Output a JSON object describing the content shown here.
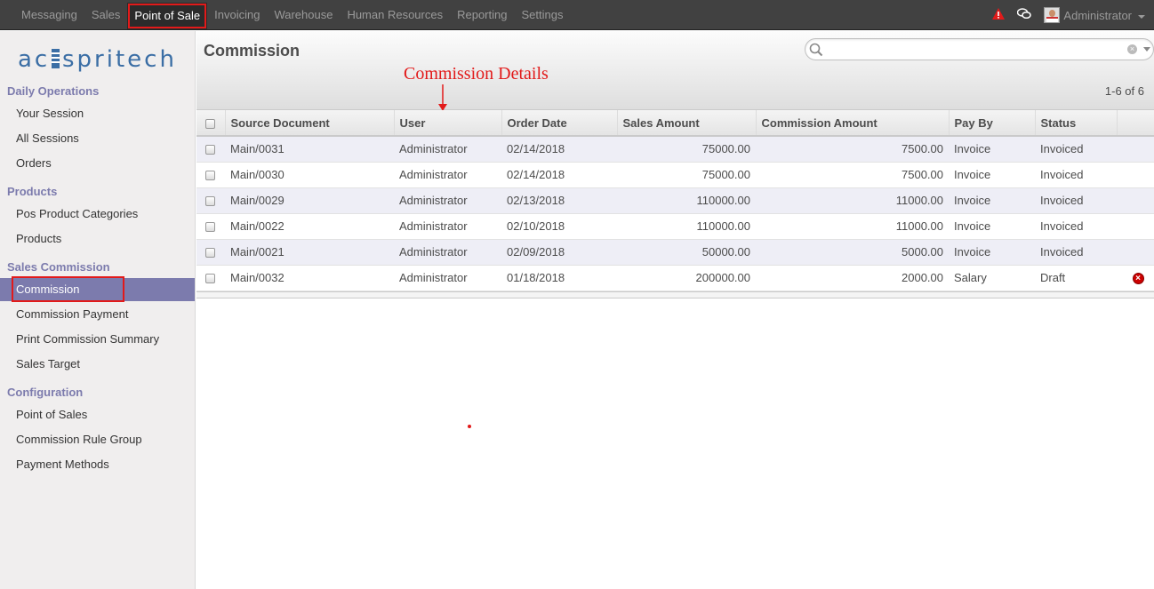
{
  "topbar": {
    "menu": [
      "Messaging",
      "Sales",
      "Point of Sale",
      "Invoicing",
      "Warehouse",
      "Human Resources",
      "Reporting",
      "Settings"
    ],
    "active_index": 2,
    "user_name": "Administrator"
  },
  "sidebar": {
    "logo_text": "acsspritech",
    "sections": [
      {
        "title": "Daily Operations",
        "items": [
          "Your Session",
          "All Sessions",
          "Orders"
        ]
      },
      {
        "title": "Products",
        "items": [
          "Pos Product Categories",
          "Products"
        ]
      },
      {
        "title": "Sales Commission",
        "items": [
          "Commission",
          "Commission Payment",
          "Print Commission Summary",
          "Sales Target"
        ]
      },
      {
        "title": "Configuration",
        "items": [
          "Point of Sales",
          "Commission Rule Group",
          "Payment Methods"
        ]
      }
    ],
    "active_item": "Commission"
  },
  "main": {
    "title": "Commission",
    "search": {
      "value": "",
      "placeholder": ""
    },
    "pager": "1-6 of 6",
    "annotation": "Commission Details"
  },
  "table": {
    "columns": [
      "Source Document",
      "User",
      "Order Date",
      "Sales Amount",
      "Commission Amount",
      "Pay By",
      "Status"
    ],
    "rows": [
      {
        "source": "Main/0031",
        "user": "Administrator",
        "date": "02/14/2018",
        "sales": "75000.00",
        "commission": "7500.00",
        "pay_by": "Invoice",
        "status": "Invoiced",
        "deletable": false
      },
      {
        "source": "Main/0030",
        "user": "Administrator",
        "date": "02/14/2018",
        "sales": "75000.00",
        "commission": "7500.00",
        "pay_by": "Invoice",
        "status": "Invoiced",
        "deletable": false
      },
      {
        "source": "Main/0029",
        "user": "Administrator",
        "date": "02/13/2018",
        "sales": "110000.00",
        "commission": "11000.00",
        "pay_by": "Invoice",
        "status": "Invoiced",
        "deletable": false
      },
      {
        "source": "Main/0022",
        "user": "Administrator",
        "date": "02/10/2018",
        "sales": "110000.00",
        "commission": "11000.00",
        "pay_by": "Invoice",
        "status": "Invoiced",
        "deletable": false
      },
      {
        "source": "Main/0021",
        "user": "Administrator",
        "date": "02/09/2018",
        "sales": "50000.00",
        "commission": "5000.00",
        "pay_by": "Invoice",
        "status": "Invoiced",
        "deletable": false
      },
      {
        "source": "Main/0032",
        "user": "Administrator",
        "date": "01/18/2018",
        "sales": "200000.00",
        "commission": "2000.00",
        "pay_by": "Salary",
        "status": "Draft",
        "deletable": true
      }
    ]
  },
  "colors": {
    "accent": "#7c7bad",
    "highlight": "#e21a1a",
    "topbar": "#414141"
  }
}
